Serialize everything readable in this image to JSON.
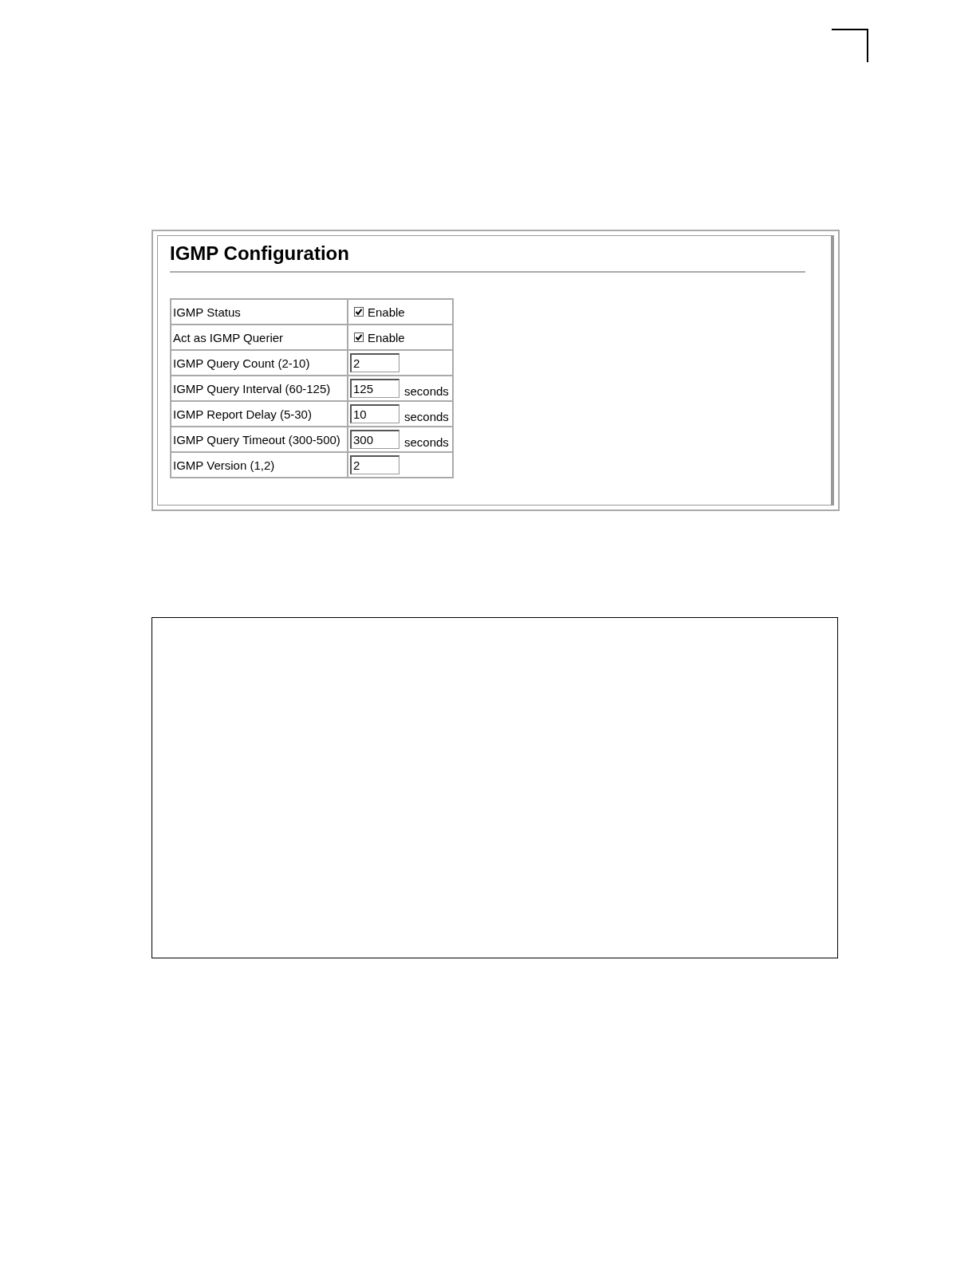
{
  "panel": {
    "title": "IGMP Configuration",
    "rows": [
      {
        "kind": "checkbox",
        "label": "IGMP Status",
        "option": "Enable",
        "checked": true
      },
      {
        "kind": "checkbox",
        "label": "Act as IGMP Querier",
        "option": "Enable",
        "checked": true
      },
      {
        "kind": "input",
        "label": "IGMP Query Count (2-10)",
        "value": "2"
      },
      {
        "kind": "input",
        "label": "IGMP Query Interval (60-125)",
        "value": "125",
        "unit": "seconds"
      },
      {
        "kind": "input",
        "label": "IGMP Report Delay (5-30)",
        "value": "10",
        "unit": "seconds"
      },
      {
        "kind": "input",
        "label": "IGMP Query Timeout (300-500)",
        "value": "300",
        "unit": "seconds"
      },
      {
        "kind": "input",
        "label": "IGMP Version (1,2)",
        "value": "2"
      }
    ]
  }
}
